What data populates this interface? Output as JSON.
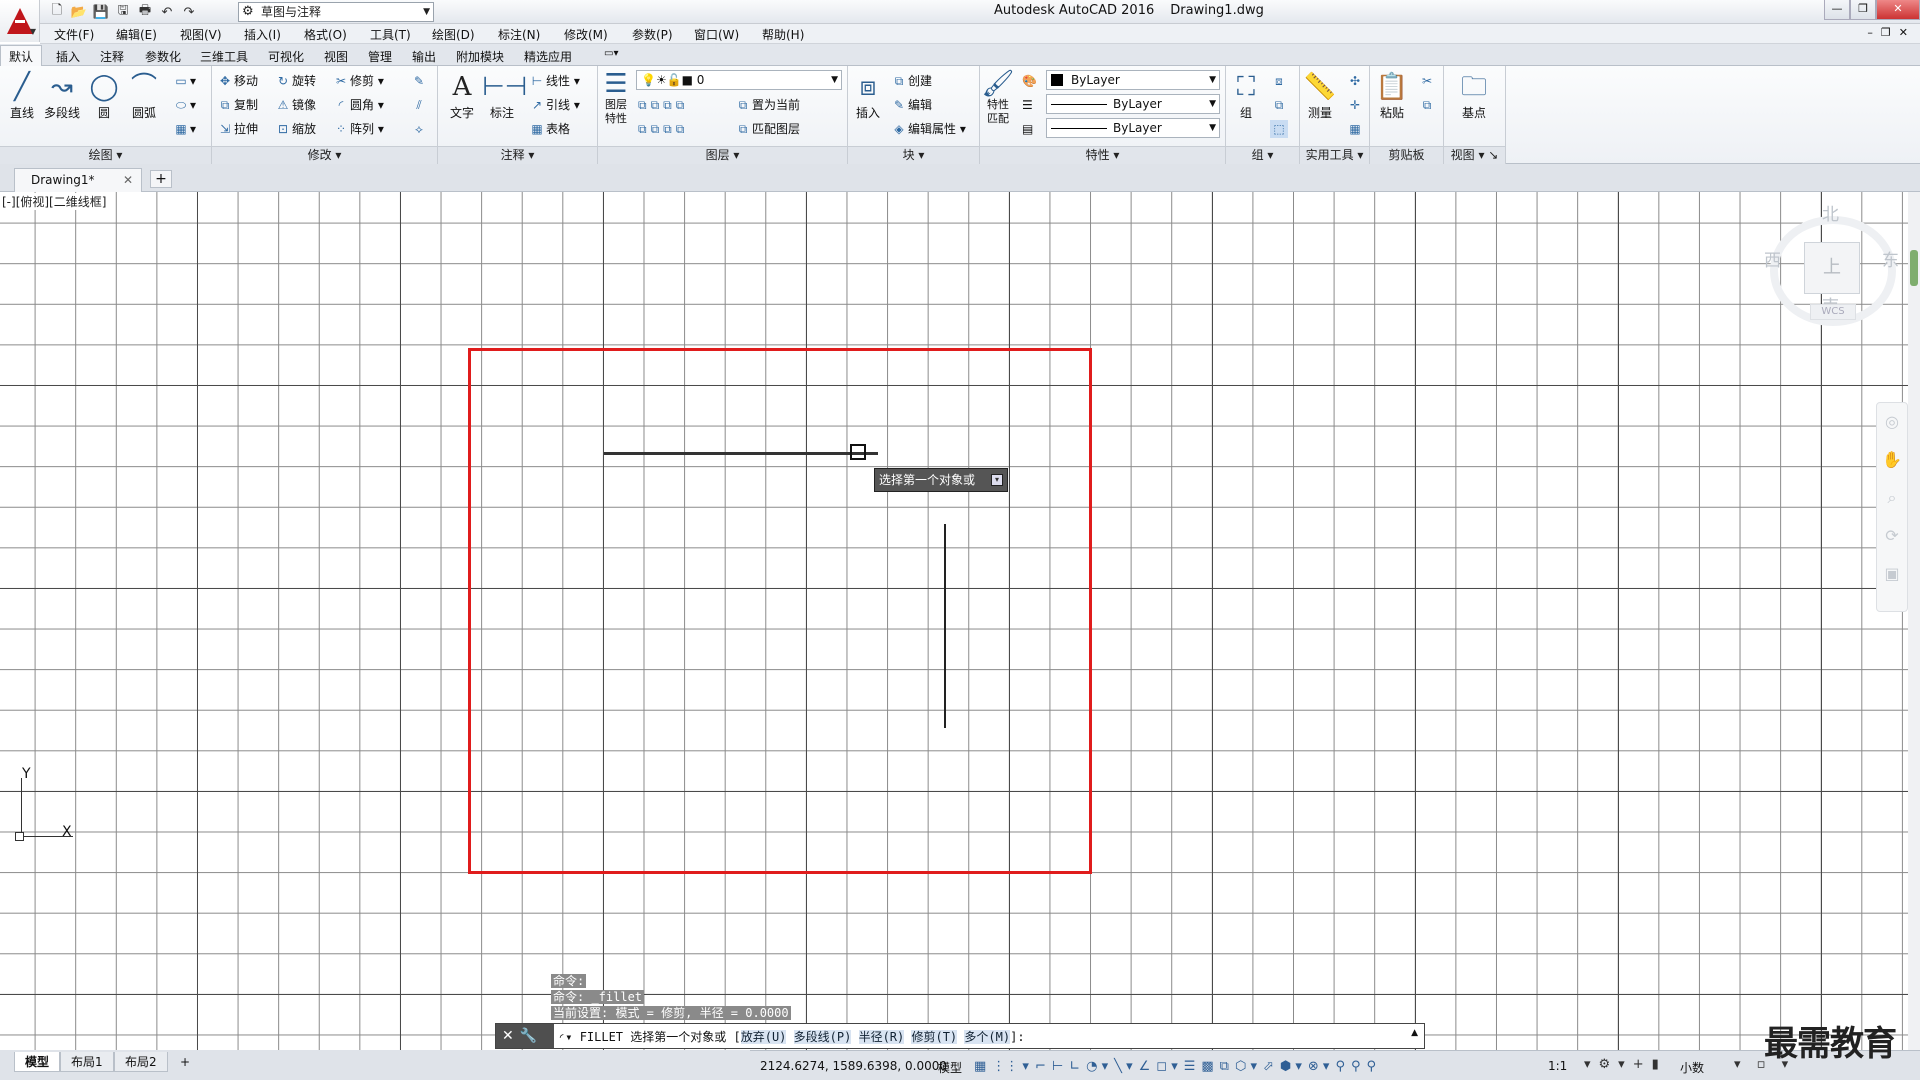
{
  "titlebar": {
    "app": "Autodesk AutoCAD 2016",
    "file": "Drawing1.dwg",
    "workspace": "草图与注释"
  },
  "menu": [
    "文件(F)",
    "编辑(E)",
    "视图(V)",
    "插入(I)",
    "格式(O)",
    "工具(T)",
    "绘图(D)",
    "标注(N)",
    "修改(M)",
    "参数(P)",
    "窗口(W)",
    "帮助(H)"
  ],
  "ribbon_tabs": [
    "默认",
    "插入",
    "注释",
    "参数化",
    "三维工具",
    "可视化",
    "视图",
    "管理",
    "输出",
    "附加模块",
    "精选应用"
  ],
  "ribbon": {
    "draw": {
      "title": "绘图",
      "line": "直线",
      "polyline": "多段线",
      "circle": "圆",
      "arc": "圆弧"
    },
    "modify": {
      "title": "修改",
      "move": "移动",
      "rotate": "旋转",
      "trim": "修剪",
      "copy": "复制",
      "mirror": "镜像",
      "fillet": "圆角",
      "stretch": "拉伸",
      "scale": "缩放",
      "array": "阵列"
    },
    "annotation": {
      "title": "注释",
      "text": "文字",
      "dimension": "标注",
      "linear": "线性",
      "leader": "引线",
      "table": "表格"
    },
    "layers": {
      "title": "图层",
      "props": "图层特性",
      "current_layer": "0",
      "set_current": "置为当前",
      "match": "匹配图层"
    },
    "block": {
      "title": "块",
      "insert": "插入",
      "create": "创建",
      "edit": "编辑",
      "edit_attr": "编辑属性"
    },
    "properties": {
      "title": "特性",
      "match": "特性匹配",
      "color": "ByLayer",
      "linetype": "ByLayer",
      "lineweight": "ByLayer"
    },
    "groups": {
      "title": "组",
      "group": "组"
    },
    "utilities": {
      "title": "实用工具",
      "measure": "测量"
    },
    "clipboard": {
      "title": "剪贴板",
      "paste": "粘贴"
    },
    "view": {
      "title": "视图",
      "base": "基点"
    }
  },
  "file_tab": "Drawing1*",
  "viewport_label": "[-][俯视][二维线框]",
  "viewcube": {
    "north": "北",
    "south": "南",
    "east": "东",
    "west": "西",
    "face": "上",
    "wcs": "WCS"
  },
  "ucs": {
    "x": "X",
    "y": "Y"
  },
  "tooltip": "选择第一个对象或",
  "history": [
    "命令:",
    "命令: _fillet",
    "当前设置: 模式 = 修剪, 半径 = 0.0000"
  ],
  "command": {
    "prefix": "FILLET 选择第一个对象或 [",
    "opt1": "放弃(U)",
    "opt2": "多段线(P)",
    "opt3": "半径(R)",
    "opt4": "修剪(T)",
    "opt5": "多个(M)",
    "suffix": "]:"
  },
  "layout_tabs": [
    "模型",
    "布局1",
    "布局2"
  ],
  "status": {
    "coords": "2124.6274, 1589.6398, 0.0000",
    "model": "模型",
    "scale": "1:1",
    "units": "小数"
  },
  "watermark": "最需教育"
}
